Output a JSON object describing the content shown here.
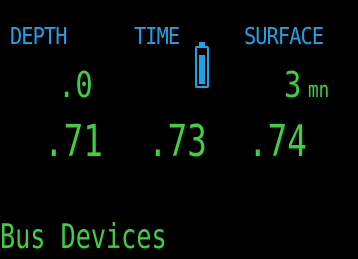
{
  "colors": {
    "background": "#000000",
    "label": "#1fa3e8",
    "value": "#3fcf3f",
    "battery": "#1fa3e8"
  },
  "header": {
    "depth_label": "DEPTH",
    "time_label": "TIME",
    "surface_label": "SURFACE"
  },
  "battery": {
    "icon": "battery-icon",
    "level_fraction": 0.85
  },
  "readings": {
    "depth_value": ".0",
    "surface_value": "3",
    "surface_unit": "mn"
  },
  "values_row": [
    ".71",
    ".73",
    ".74"
  ],
  "footer": {
    "message": "Bus Devices"
  }
}
